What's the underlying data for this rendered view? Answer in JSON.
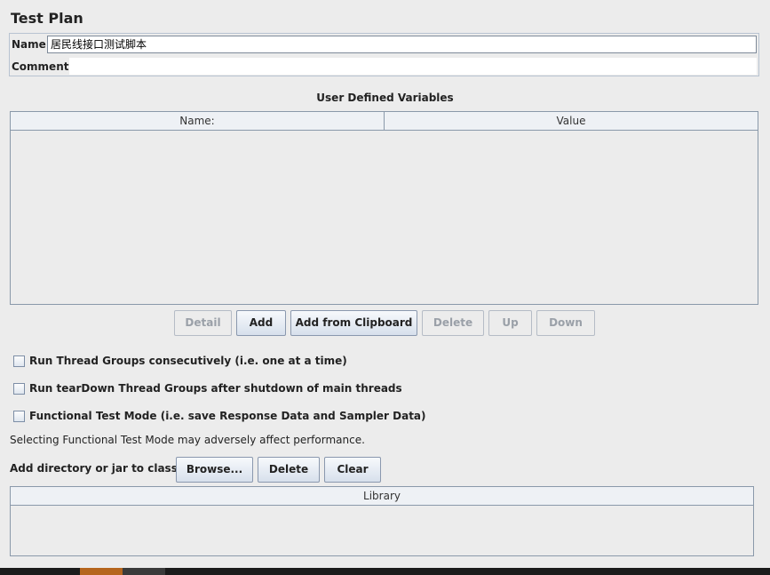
{
  "header": {
    "title": "Test Plan"
  },
  "form": {
    "name_label": "Name:",
    "name_value": "居民线接口测试脚本",
    "comments_label": "Comments:",
    "comments_value": ""
  },
  "variables": {
    "section_title": "User Defined Variables",
    "columns": [
      "Name:",
      "Value"
    ],
    "rows": []
  },
  "buttons": {
    "detail": "Detail",
    "add": "Add",
    "add_from_clipboard": "Add from Clipboard",
    "delete": "Delete",
    "up": "Up",
    "down": "Down"
  },
  "options": [
    {
      "label": "Run Thread Groups consecutively (i.e. one at a time)",
      "checked": false
    },
    {
      "label": "Run tearDown Thread Groups after shutdown of main threads",
      "checked": false
    },
    {
      "label": "Functional Test Mode (i.e. save Response Data and Sampler Data)",
      "checked": false
    }
  ],
  "note": "Selecting Functional Test Mode may adversely affect performance.",
  "classpath": {
    "label": "Add directory or jar to classpath",
    "browse": "Browse...",
    "delete": "Delete",
    "clear": "Clear",
    "library_header": "Library",
    "rows": []
  },
  "colors": {
    "accent": "#d7e0ec",
    "border": "#8a99aa",
    "background": "#ececec"
  }
}
